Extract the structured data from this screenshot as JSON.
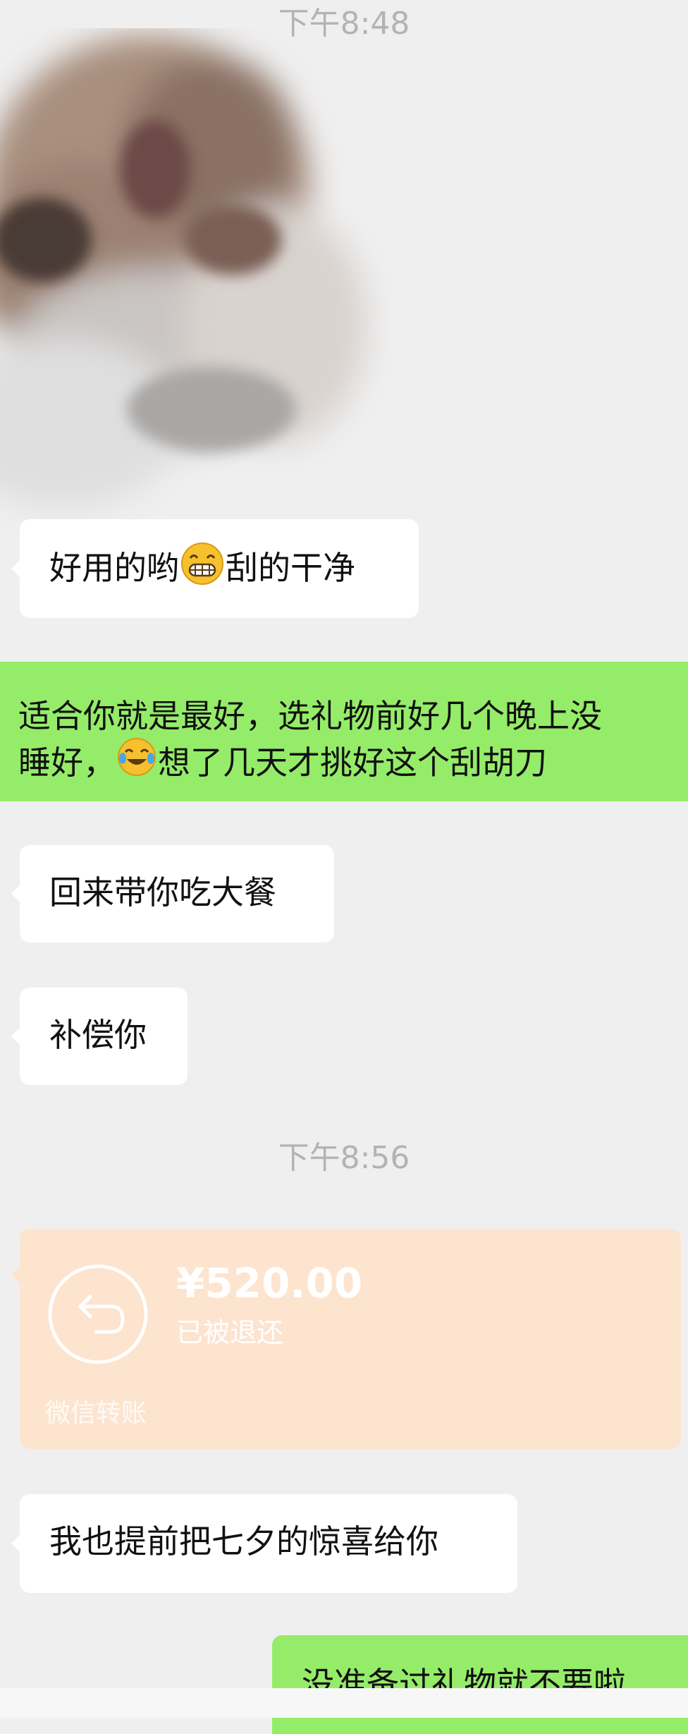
{
  "timestamps": [
    "下午8:48",
    "下午8:56"
  ],
  "messages": {
    "m1": {
      "before": "好用的哟",
      "emoji": "grinning-face-emoji",
      "after": "刮的干净"
    },
    "m2": {
      "line1": "适合你就是最好，选礼物前好几个晚上没",
      "line2_before": "睡好，",
      "emoji": "tears-of-joy-emoji",
      "line2_after": "想了几天才挑好这个刮胡刀"
    },
    "m3": "回来带你吃大餐",
    "m4": "补偿你",
    "m5": "我也提前把七夕的惊喜给你",
    "m6": "没准备过礼物就不要啦"
  },
  "transfer": {
    "amount": "¥520.00",
    "status": "已被退还",
    "label": "微信转账",
    "icon": "return-arrow-icon"
  },
  "colors": {
    "background": "#efefef",
    "incoming_bubble": "#ffffff",
    "outgoing_bubble": "#95ec69",
    "transfer_card": "#fde4cf",
    "timestamp_text": "#b3b3b3"
  }
}
